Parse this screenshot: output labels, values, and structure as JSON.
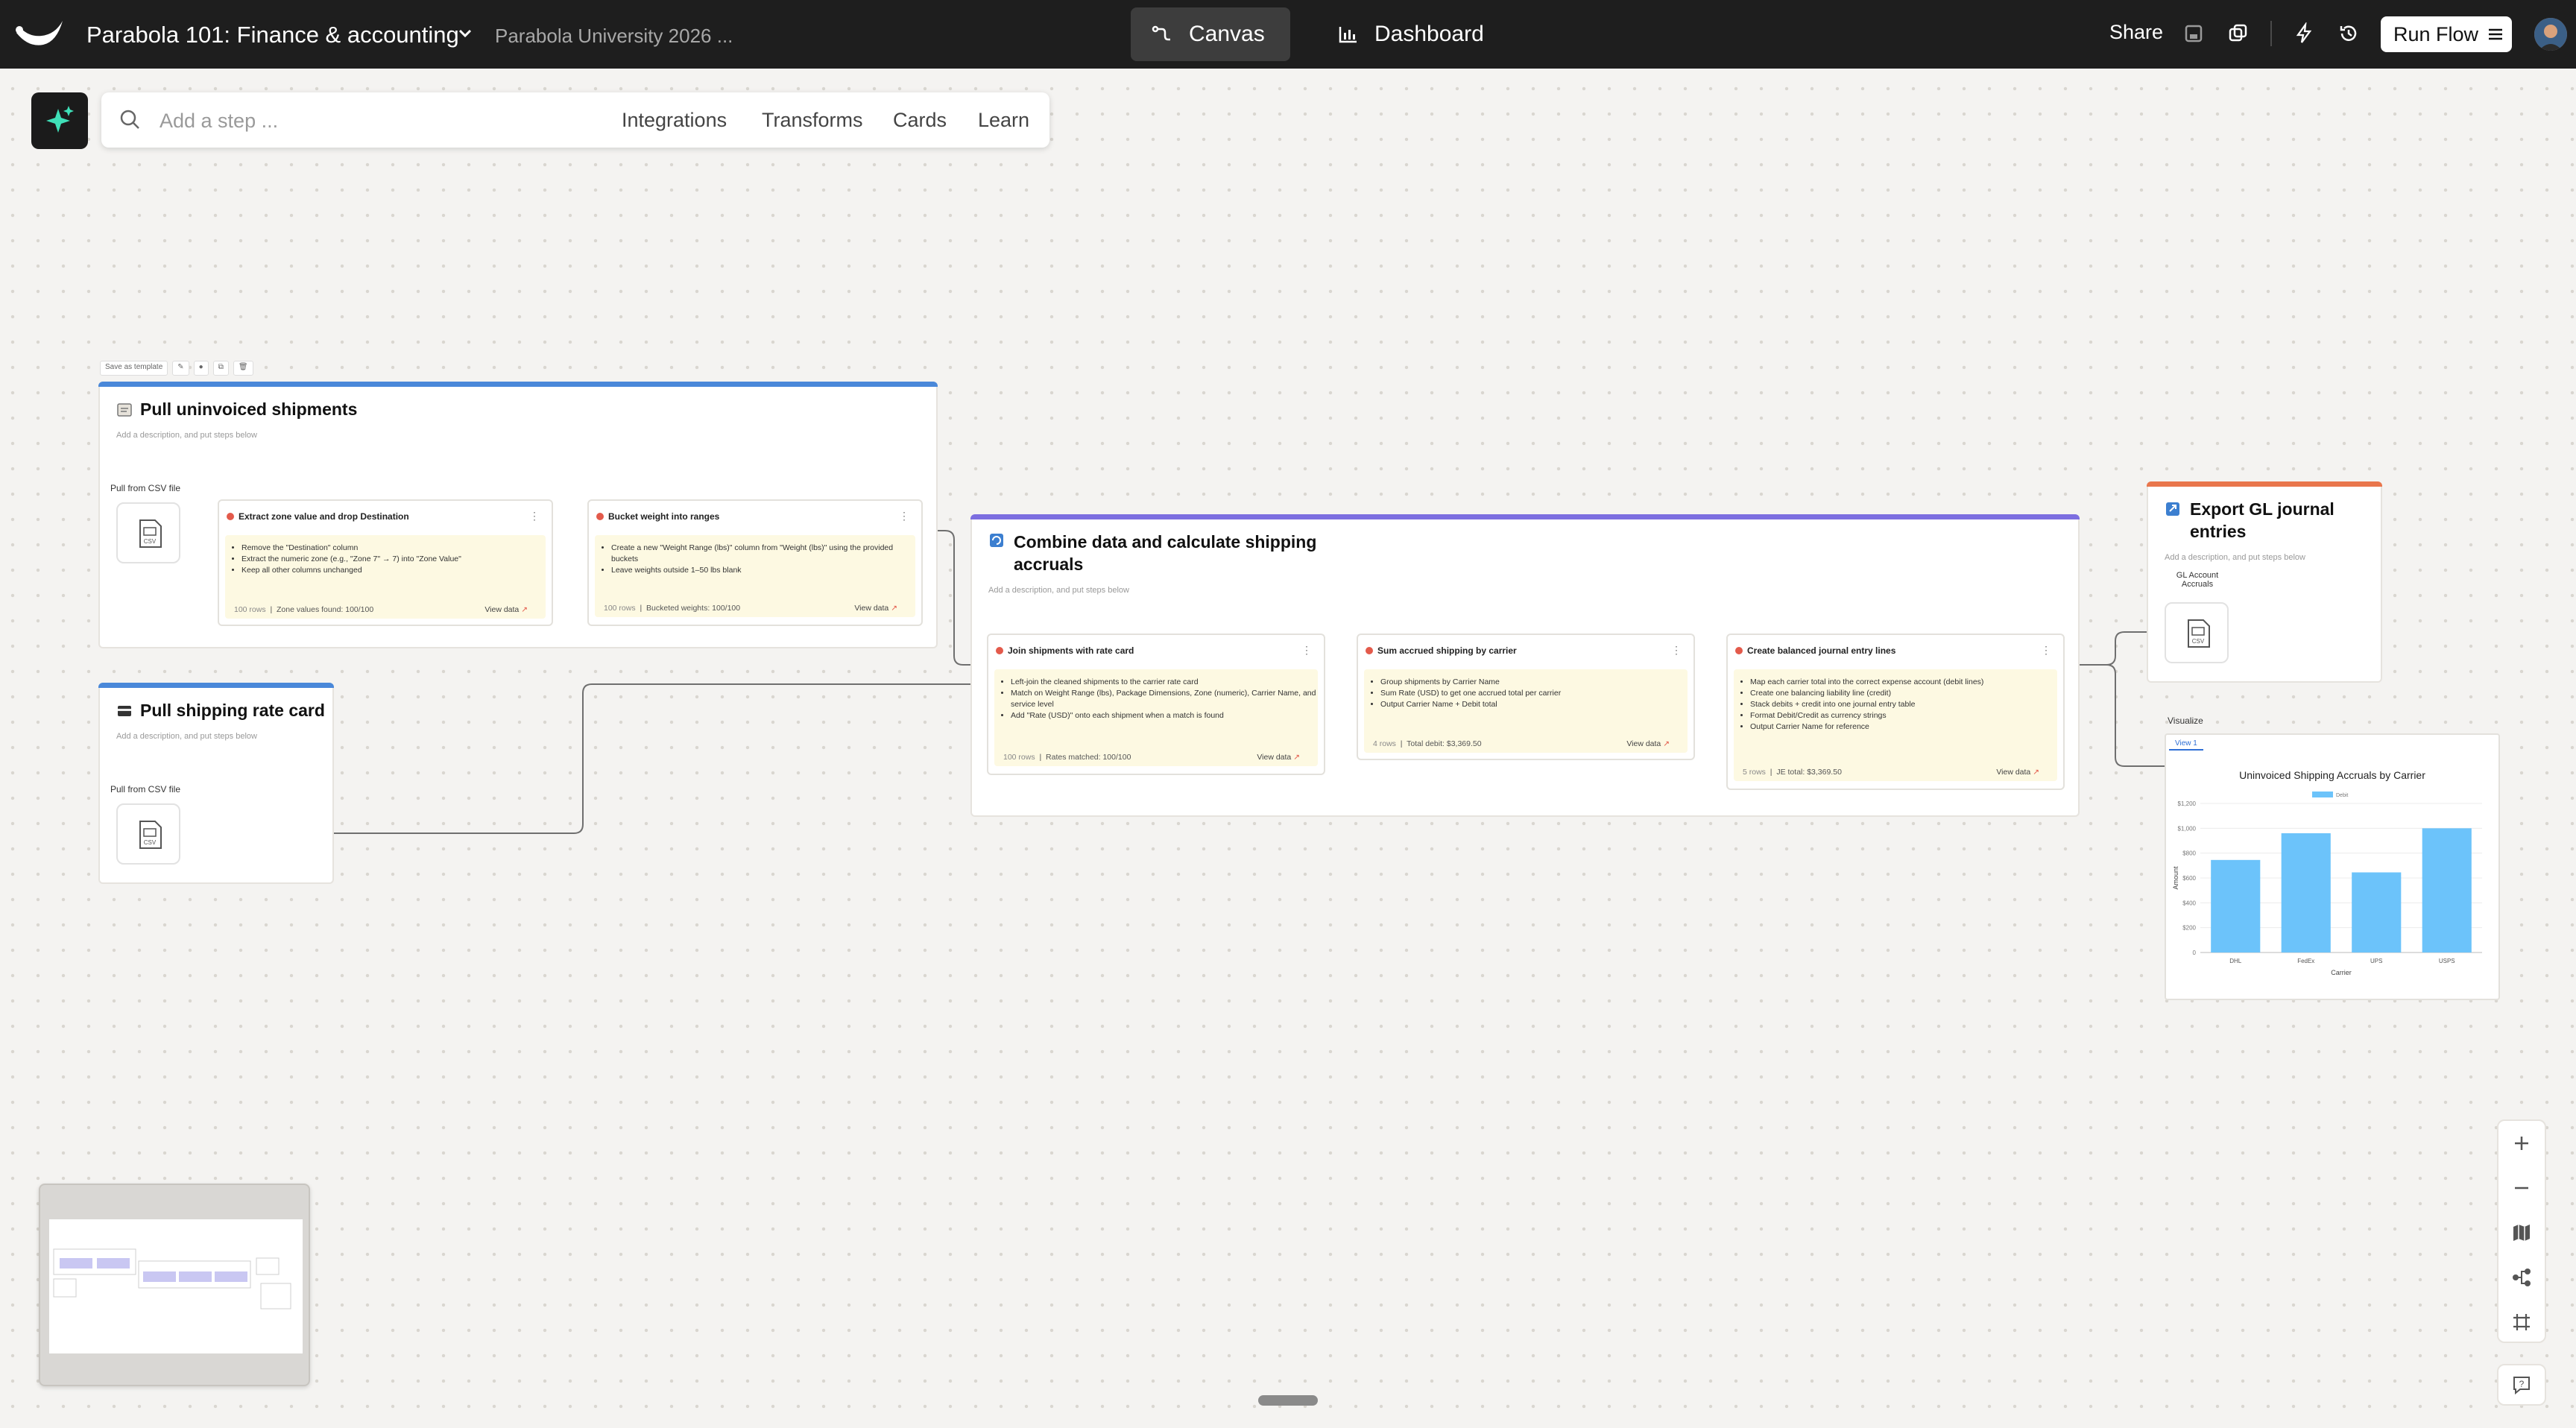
{
  "header": {
    "app_title": "Parabola 101: Finance & accounting",
    "org_name": "Parabola University 2026 ...",
    "tab_canvas": "Canvas",
    "tab_dashboard": "Dashboard",
    "share_label": "Share",
    "run_flow_label": "Run Flow"
  },
  "toolbar": {
    "search_placeholder": "Add a step ...",
    "links": [
      "Integrations",
      "Transforms",
      "Cards",
      "Learn"
    ]
  },
  "template_bar": {
    "save_label": "Save as template"
  },
  "groups": {
    "pull_shipments": {
      "title": "Pull uninvoiced shipments",
      "desc": "Add a description, and put steps below",
      "source_label": "Pull from CSV file",
      "steps": [
        {
          "title": "Extract zone value and drop Destination",
          "bullets": [
            "Remove the \"Destination\" column",
            "Extract the numeric zone (e.g., \"Zone 7\" → 7) into \"Zone Value\"",
            "Keep all other columns unchanged"
          ],
          "rows": "100 rows",
          "stat": "Zone values found: 100/100",
          "view": "View data"
        },
        {
          "title": "Bucket weight into ranges",
          "bullets": [
            "Create a new \"Weight Range (lbs)\" column from \"Weight (lbs)\" using the provided buckets",
            "Leave weights outside 1–50 lbs blank"
          ],
          "rows": "100 rows",
          "stat": "Bucketed weights: 100/100",
          "view": "View data"
        }
      ]
    },
    "pull_rate_card": {
      "title": "Pull shipping rate card",
      "desc": "Add a description, and put steps below",
      "source_label": "Pull from CSV file"
    },
    "combine": {
      "title": "Combine data and calculate shipping accruals",
      "desc": "Add a description, and put steps below",
      "steps": [
        {
          "title": "Join shipments with rate card",
          "bullets": [
            "Left-join the cleaned shipments to the carrier rate card",
            "Match on Weight Range (lbs), Package Dimensions, Zone (numeric), Carrier Name, and service level",
            "Add \"Rate (USD)\" onto each shipment when a match is found"
          ],
          "rows": "100 rows",
          "stat": "Rates matched: 100/100",
          "view": "View data"
        },
        {
          "title": "Sum accrued shipping by carrier",
          "bullets": [
            "Group shipments by Carrier Name",
            "Sum Rate (USD) to get one accrued total per carrier",
            "Output Carrier Name + Debit total"
          ],
          "rows": "4 rows",
          "stat": "Total debit: $3,369.50",
          "view": "View data"
        },
        {
          "title": "Create balanced journal entry lines",
          "bullets": [
            "Map each carrier total into the correct expense account (debit lines)",
            "Create one balancing liability line (credit)",
            "Stack debits + credit into one journal entry table",
            "Format Debit/Credit as currency strings",
            "Output Carrier Name for reference"
          ],
          "rows": "5 rows",
          "stat": "JE total: $3,369.50",
          "view": "View data"
        }
      ]
    },
    "export": {
      "title": "Export GL journal entries",
      "desc": "Add a description, and put steps below",
      "dest_label": "GL Account Accruals"
    }
  },
  "visualize": {
    "label": "Visualize",
    "tab": "View 1"
  },
  "chart_data": {
    "type": "bar",
    "title": "Uninvoiced Shipping Accruals by Carrier",
    "xlabel": "Carrier",
    "ylabel": "Amount",
    "legend": [
      "Debit"
    ],
    "legend_position": "top-center",
    "categories": [
      "DHL",
      "FedEx",
      "UPS",
      "USPS"
    ],
    "series": [
      {
        "name": "Debit",
        "values": [
          745,
          960,
          645,
          1000
        ]
      }
    ],
    "yticks": [
      "0",
      "$200",
      "$400",
      "$600",
      "$800",
      "$1,000",
      "$1,200"
    ],
    "ylim": [
      0,
      1200
    ],
    "grid": true,
    "bar_color": "#6cc3fa"
  },
  "colors": {
    "accent_blue": "#4a88d9",
    "accent_purple": "#7c6ee0",
    "accent_orange": "#e9764c"
  }
}
